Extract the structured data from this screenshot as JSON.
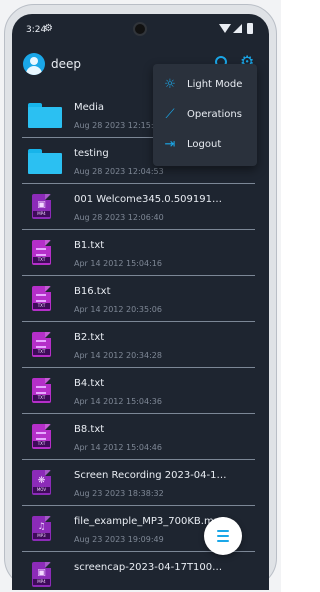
{
  "status_bar": {
    "time": "3:24",
    "icons": [
      "settings-icon",
      "wifi-icon",
      "signal-icon",
      "battery-icon"
    ]
  },
  "header": {
    "username": "deep",
    "avatar_icon": "person-icon",
    "actions": [
      "search-icon",
      "settings-icon"
    ]
  },
  "overflow_menu": {
    "items": [
      {
        "label": "Light Mode",
        "icon": "brightness-icon"
      },
      {
        "label": "Operations",
        "icon": "chart-icon"
      },
      {
        "label": "Logout",
        "icon": "logout-icon"
      }
    ]
  },
  "files": [
    {
      "name": "Media",
      "date": "Aug 28 2023 12:15:2",
      "type": "folder"
    },
    {
      "name": "testing",
      "date": "Aug 28 2023 12:04:53",
      "type": "folder"
    },
    {
      "name": "001 Welcome345.0.5091910574...",
      "date": "Aug 28 2023 12:06:40",
      "type": "MP4"
    },
    {
      "name": "B1.txt",
      "date": "Apr 14 2012 15:04:16",
      "type": "TXT"
    },
    {
      "name": "B16.txt",
      "date": "Apr 14 2012 20:35:06",
      "type": "TXT"
    },
    {
      "name": "B2.txt",
      "date": "Apr 14 2012 20:34:28",
      "type": "TXT"
    },
    {
      "name": "B4.txt",
      "date": "Apr 14 2012 15:04:36",
      "type": "TXT"
    },
    {
      "name": "B8.txt",
      "date": "Apr 14 2012 15:04:46",
      "type": "TXT"
    },
    {
      "name": "Screen Recording 2023-04-19 ...",
      "date": "Aug 23 2023 18:38:32",
      "type": "MOV"
    },
    {
      "name": "file_example_MP3_700KB.mp3",
      "date": "Aug 23 2023 19:09:49",
      "type": "MP3"
    },
    {
      "name": "screencap-2023-04-17T100344...",
      "date": "",
      "type": "MP4"
    }
  ],
  "fab": {
    "icon": "menu-icon"
  },
  "colors": {
    "accent": "#1aa7e8",
    "background": "#1e2530",
    "folder": "#2bc0f2",
    "file": "#b52fc9"
  }
}
